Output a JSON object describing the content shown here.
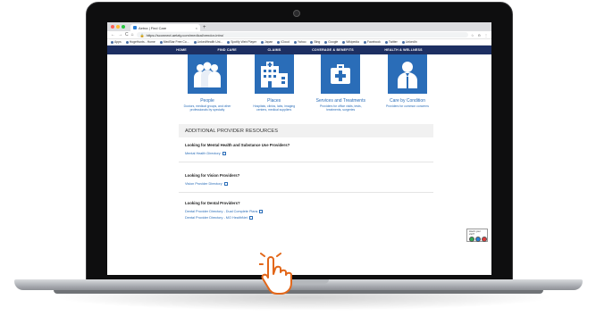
{
  "browser": {
    "tab_title": "Aetna | Find Care",
    "new_tab_symbol": "+",
    "tab_close_symbol": "×",
    "url": "https://sconnect.aetaly.com/medical/vendor-intro/",
    "back_symbol": "←",
    "forward_symbol": "→",
    "reload_symbol": "C",
    "home_symbol": "⌂",
    "right_icons": [
      "☆",
      "⊖",
      "⋮"
    ],
    "bookmarks": [
      "Apps",
      "HogeHunts - Home",
      "MedStar Free Co...",
      "LinkedHealth Uni...",
      "Spotify Web Player",
      "Japan",
      "iCloud",
      "Yahoo",
      "Bing",
      "Google",
      "Wikipedia",
      "Facebook",
      "Twitter",
      "LinkedIn"
    ]
  },
  "site_nav": [
    "HOME",
    "FIND CARE",
    "CLAIMS",
    "COVERAGE & BENEFITS",
    "HEALTH & WELLNESS"
  ],
  "cards": [
    {
      "title": "People",
      "description": "Doctors, medical groups, and other professionals by specialty",
      "icon": "people-icon"
    },
    {
      "title": "Places",
      "description": "Hospitals, clinics, labs, imaging centers, medical suppliers",
      "icon": "hospital-icon"
    },
    {
      "title": "Services and Treatments",
      "description": "Providers for office visits, tests, treatments, surgeries",
      "icon": "medical-kit-icon"
    },
    {
      "title": "Care by Condition",
      "description": "Providers for common concerns",
      "icon": "doctor-icon"
    }
  ],
  "resources": {
    "header": "ADDITIONAL PROVIDER RESOURCES",
    "sections": [
      {
        "question": "Looking for Mental Health and Substance Use Providers?",
        "links": [
          "Mental Health Directory"
        ]
      },
      {
        "question": "Looking for Vision Providers?",
        "links": [
          "Vision Provider Directory"
        ]
      },
      {
        "question": "Looking for Dental Providers?",
        "links": [
          "Dental Provider Directory - Dual Complete Plans",
          "Dental Provider Directory - MO HealthNet"
        ]
      }
    ]
  },
  "feedback": {
    "label": "How's your visit?"
  },
  "colors": {
    "nav": "#1d2f62",
    "tile": "#2a6db8",
    "link": "#2a6db8"
  }
}
